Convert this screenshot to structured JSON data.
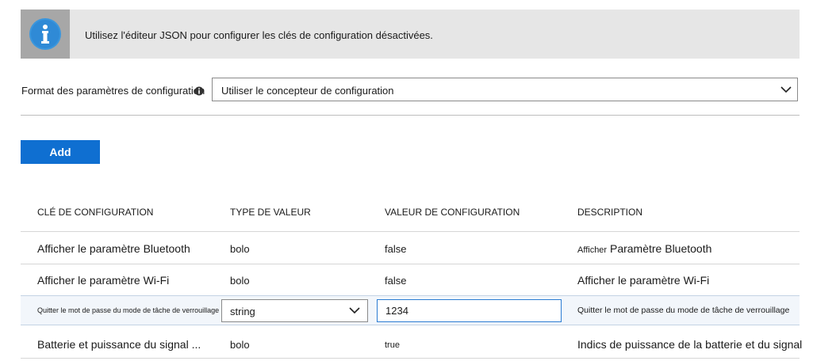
{
  "banner": {
    "icon": "info-icon",
    "text": "Utilisez l'éditeur JSON pour configurer les clés de configuration désactivées."
  },
  "format": {
    "label": "Format des paramètres de configuration",
    "info_icon": "info-icon",
    "selected": "Utiliser le concepteur de configuration"
  },
  "add_label": "Add",
  "colors": {
    "accent": "#0f6fd1",
    "banner_bg": "#e6e6e6",
    "icon_bg": "#a7a7a7"
  },
  "table": {
    "headers": [
      "CLÉ DE CONFIGURATION",
      "TYPE DE VALEUR",
      "VALEUR DE CONFIGURATION",
      "DESCRIPTION"
    ],
    "rows": [
      {
        "key": "Afficher le paramètre Bluetooth",
        "type": "bolo",
        "value": "false",
        "desc_prefix": "Afficher",
        "desc": "Paramètre Bluetooth"
      },
      {
        "key": "Afficher le paramètre Wi-Fi",
        "type": "bolo",
        "value": "false",
        "desc": "Afficher le paramètre Wi-Fi"
      },
      {
        "key": "Quitter le mot de passe du mode de tâche de verrouillage",
        "type": "string",
        "value": "1234",
        "desc": "Quitter le mot de passe du mode de tâche de verrouillage"
      },
      {
        "key": "Batterie et puissance du signal ...",
        "type": "bolo",
        "value": "true",
        "desc": "Indics de puissance de la batterie et du signal"
      }
    ]
  }
}
